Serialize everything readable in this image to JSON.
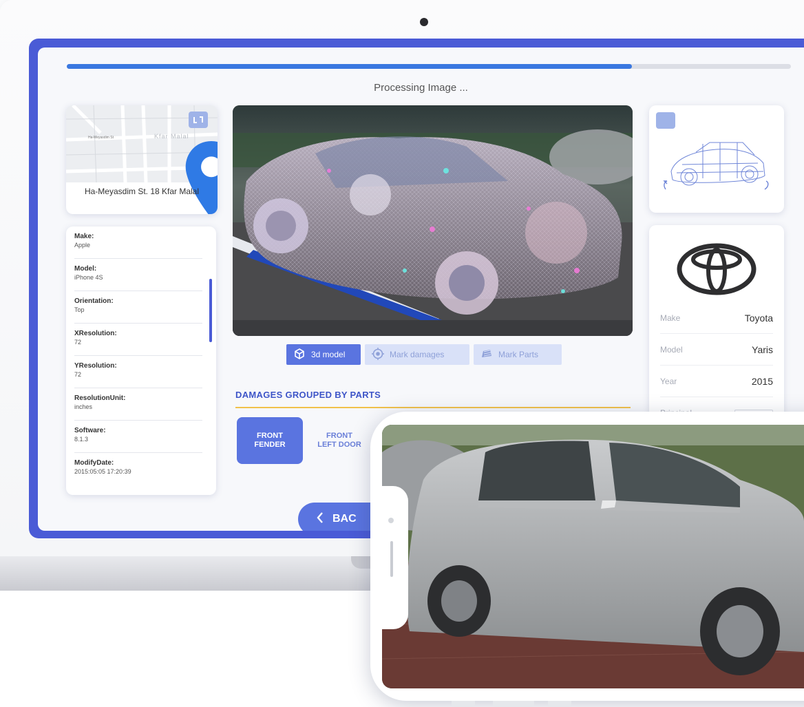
{
  "progress": {
    "label": "Processing Image ...",
    "percent": 78
  },
  "location": {
    "street_label": "Ha-Meyasdim St",
    "area_label": "Kfar Malal",
    "address": "Ha-Meyasdim St. 18 Kfar Malal",
    "pin_icon": "map-pin-icon",
    "expand_icon": "expand-icon"
  },
  "metadata": [
    {
      "key": "Make:",
      "value": "Apple"
    },
    {
      "key": "Model:",
      "value": "iPhone 4S"
    },
    {
      "key": "Orientation:",
      "value": "Top"
    },
    {
      "key": "XResolution:",
      "value": "72"
    },
    {
      "key": "YResolution:",
      "value": "72"
    },
    {
      "key": "ResolutionUnit:",
      "value": "inches"
    },
    {
      "key": "Software:",
      "value": "8.1.3"
    },
    {
      "key": "ModifyDate:",
      "value": "2015:05:05  17:20:39"
    }
  ],
  "tabs": [
    {
      "label": "3d model",
      "icon": "cube-icon",
      "active": true
    },
    {
      "label": "Mark damages",
      "icon": "target-icon",
      "active": false
    },
    {
      "label": "Mark Parts",
      "icon": "car-part-icon",
      "active": false
    }
  ],
  "damages": {
    "title": "DAMAGES GROUPED  BY PARTS",
    "parts": [
      {
        "line1": "FRONT",
        "line2": "FENDER",
        "active": true
      },
      {
        "line1": "FRONT",
        "line2": "LEFT DOOR",
        "active": false
      }
    ]
  },
  "back_button": {
    "label": "BAC",
    "icon": "chevron-left-icon"
  },
  "vehicle": {
    "brand_icon": "toyota-logo",
    "specs": [
      {
        "key": "Make",
        "value": "Toyota"
      },
      {
        "key": "Model",
        "value": "Yaris"
      },
      {
        "key": "Year",
        "value": "2015"
      },
      {
        "key": "Principal",
        "value": ""
      }
    ]
  },
  "colors": {
    "accent": "#5a74e0",
    "frame": "#4a5bd6",
    "progress": "#3a78e0",
    "section_rule": "#f1c14a"
  }
}
